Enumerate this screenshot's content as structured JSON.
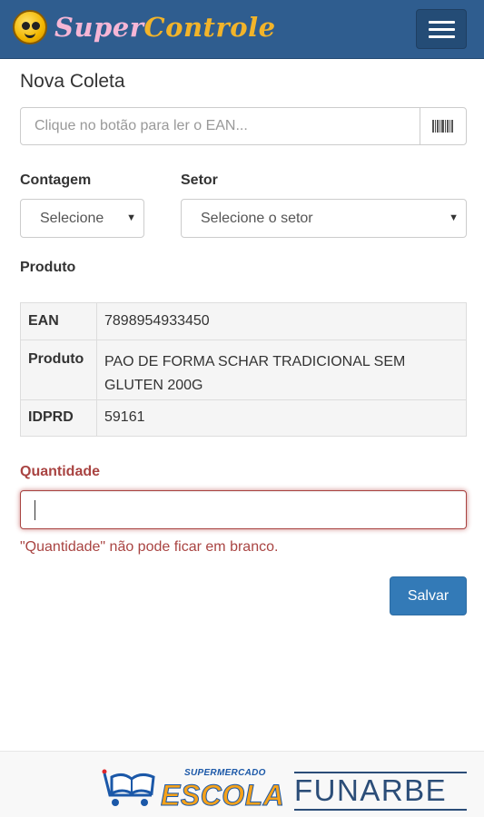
{
  "navbar": {
    "brand_super": "Super",
    "brand_controle": "Controle",
    "menu_icon": "hamburger-menu-icon"
  },
  "page": {
    "title": "Nova Coleta"
  },
  "ean_field": {
    "placeholder": "Clique no botão para ler o EAN...",
    "button_icon": "barcode-icon"
  },
  "contagem": {
    "label": "Contagem",
    "selected": "Selecione"
  },
  "setor": {
    "label": "Setor",
    "selected": "Selecione o setor"
  },
  "produto_section": {
    "label": "Produto"
  },
  "product_table": {
    "rows": [
      {
        "key": "EAN",
        "value": "7898954933450"
      },
      {
        "key": "Produto",
        "value": "PAO DE FORMA SCHAR TRADICIONAL SEM GLUTEN 200G"
      },
      {
        "key": "IDPRD",
        "value": "59161"
      }
    ]
  },
  "quantidade": {
    "label": "Quantidade",
    "value": "",
    "error": "\"Quantidade\" não pode ficar em branco."
  },
  "actions": {
    "save_label": "Salvar"
  },
  "footer": {
    "escola_small": "SUPERMERCADO",
    "escola_big": "ESCOLA",
    "funarbe": "FUNARBE"
  },
  "colors": {
    "navbar": "#2f5d8f",
    "primary": "#337ab7",
    "error": "#a94442",
    "brand_pink": "#f6b6d6",
    "brand_gold": "#f2b42a"
  }
}
